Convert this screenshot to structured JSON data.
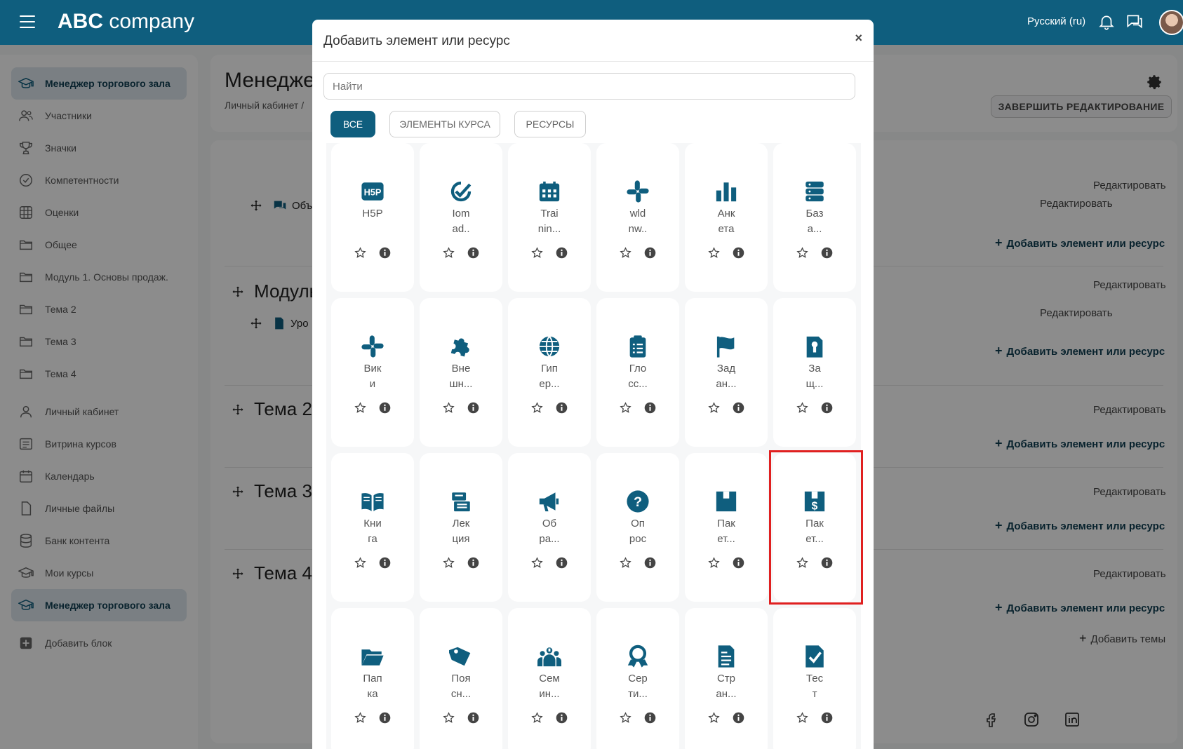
{
  "navbar": {
    "brand_bold": "ABC",
    "brand_rest": " company",
    "language": "Русский (ru)"
  },
  "sidebar": {
    "items": [
      {
        "label": "Менеджер торгового зала",
        "icon": "graduation-cap-icon",
        "active": true
      },
      {
        "label": "Участники",
        "icon": "users-icon"
      },
      {
        "label": "Значки",
        "icon": "trophy-icon"
      },
      {
        "label": "Компетентности",
        "icon": "check-circle-icon"
      },
      {
        "label": "Оценки",
        "icon": "grid-table-icon"
      },
      {
        "label": "Общее",
        "icon": "folder-icon"
      },
      {
        "label": "Модуль 1. Основы продаж.",
        "icon": "folder-icon"
      },
      {
        "label": "Тема 2",
        "icon": "folder-icon"
      },
      {
        "label": "Тема 3",
        "icon": "folder-icon"
      },
      {
        "label": "Тема 4",
        "icon": "folder-icon"
      },
      {
        "label": "Личный кабинет",
        "icon": "user-icon"
      },
      {
        "label": "Витрина курсов",
        "icon": "list-icon"
      },
      {
        "label": "Календарь",
        "icon": "calendar-icon"
      },
      {
        "label": "Личные файлы",
        "icon": "file-icon"
      },
      {
        "label": "Банк контента",
        "icon": "database-icon"
      },
      {
        "label": "Мои курсы",
        "icon": "graduation-cap-icon"
      },
      {
        "label": "Менеджер торгового зала",
        "icon": "graduation-cap-icon",
        "active": true
      },
      {
        "label": "Добавить блок",
        "icon": "plus-square-icon"
      }
    ]
  },
  "header": {
    "title": "Менедже",
    "breadcrumb": "Личный кабинет /",
    "finish_editing": "ЗАВЕРШИТЬ РЕДАКТИРОВАНИЕ"
  },
  "sections": [
    {
      "title": "",
      "activity": "Объ",
      "edit": "Редактировать",
      "edit2": "Редактировать",
      "add": "Добавить элемент или ресурс"
    },
    {
      "title": "Модуль",
      "activity": "Уро",
      "edit": "Редактировать",
      "edit2": "Редактировать",
      "add": "Добавить элемент или ресурс"
    },
    {
      "title": "Тема 2",
      "edit": "Редактировать",
      "add": "Добавить элемент или ресурс"
    },
    {
      "title": "Тема 3",
      "edit": "Редактировать",
      "add": "Добавить элемент или ресурс"
    },
    {
      "title": "Тема 4",
      "edit": "Редактировать",
      "add": "Добавить элемент или ресурс"
    }
  ],
  "add_topics": "Добавить темы",
  "modal": {
    "title": "Добавить элемент или ресурс",
    "close": "×",
    "search_placeholder": "Найти",
    "tabs": {
      "all": "ВСЕ",
      "elements": "ЭЛЕМЕНТЫ КУРСА",
      "resources": "РЕСУРСЫ"
    },
    "tiles": [
      {
        "name": "H5P",
        "icon": "h5p-icon"
      },
      {
        "name": "Iom\nad..",
        "icon": "check-badge-icon"
      },
      {
        "name": "Trai\nnin...",
        "icon": "calendar-icon"
      },
      {
        "name": "wld\nnw..",
        "icon": "slack-icon"
      },
      {
        "name": "Анк\nета",
        "icon": "bar-chart-icon"
      },
      {
        "name": "Баз\nа...",
        "icon": "database-icon"
      },
      {
        "name": "Вик\nи",
        "icon": "slack-icon"
      },
      {
        "name": "Вне\nшн...",
        "icon": "puzzle-icon"
      },
      {
        "name": "Гип\nер...",
        "icon": "globe-icon"
      },
      {
        "name": "Гло\nсс...",
        "icon": "clipboard-list-icon"
      },
      {
        "name": "Зад\nан...",
        "icon": "flag-icon"
      },
      {
        "name": "За\nщ...",
        "icon": "lock-file-icon"
      },
      {
        "name": "Кни\nга",
        "icon": "book-open-icon"
      },
      {
        "name": "Лек\nция",
        "icon": "lecture-icon"
      },
      {
        "name": "Об\nра...",
        "icon": "megaphone-icon"
      },
      {
        "name": "Оп\nрос",
        "icon": "question-circle-icon"
      },
      {
        "name": "Пак\nет...",
        "icon": "package-icon"
      },
      {
        "name": "Пак\nет...",
        "icon": "package-dollar-icon",
        "highlighted": true
      },
      {
        "name": "Пап\nка",
        "icon": "folder-open-icon"
      },
      {
        "name": "Поя\nсн...",
        "icon": "tag-icon"
      },
      {
        "name": "Сем\nин...",
        "icon": "people-group-icon"
      },
      {
        "name": "Сер\nти...",
        "icon": "certificate-icon"
      },
      {
        "name": "Стр\nан...",
        "icon": "page-icon"
      },
      {
        "name": "Тес\nт",
        "icon": "check-file-icon"
      }
    ]
  },
  "colors": {
    "navbar": "#0f5e7e",
    "accent": "#0f5e7e",
    "highlight": "#e02020"
  }
}
